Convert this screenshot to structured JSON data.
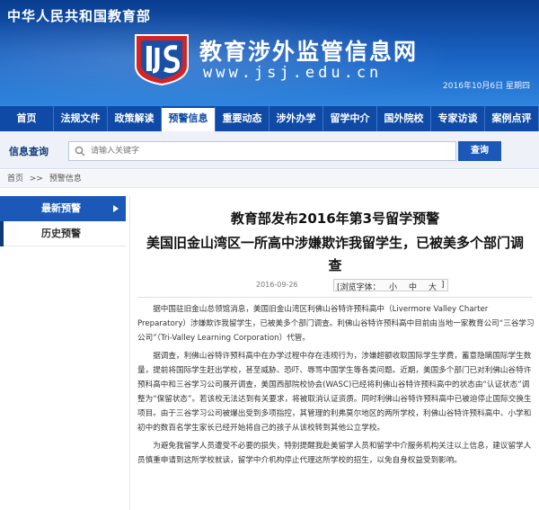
{
  "header": {
    "ministry": "中华人民共和国教育部",
    "site_title": "教育涉外监管信息网",
    "site_url": "www.jsj.edu.cn",
    "date": "2016年10月6日 星期四"
  },
  "nav": {
    "items": [
      "首页",
      "法规文件",
      "政策解读",
      "预警信息",
      "重要动态",
      "涉外办学",
      "留学中介",
      "国外院校",
      "专家访谈",
      "案例点评"
    ],
    "active_index": 3
  },
  "search": {
    "label": "信息查询",
    "placeholder": "请输入关键字",
    "button": "查询"
  },
  "breadcrumb": {
    "home": "首页",
    "sep": ">>",
    "current": "预警信息"
  },
  "sidebar": {
    "items": [
      {
        "label": "最新预警",
        "active": true
      },
      {
        "label": "历史预警",
        "active": false
      }
    ]
  },
  "article": {
    "title_line1": "教育部发布2016年第3号留学预警",
    "title_line2": "美国旧金山湾区一所高中涉嫌欺诈我留学生，已被美多个部门调查",
    "pub_date": "2016-09-26",
    "font_label": "[浏览字体：",
    "font_small": "小",
    "font_medium": "中",
    "font_large": "大",
    "font_end": "]",
    "paragraphs": [
      "据中国驻旧金山总领馆消息，美国旧金山湾区利佛山谷特许预科高中（Livermore Valley Charter Preparatory）涉嫌欺诈我留学生，已被美多个部门调查。利佛山谷特许预科高中目前由当地一家教育公司“三谷学习公司”（Tri-Valley Learning Corporation）代管。",
      "据调查，利佛山谷特许预科高中在办学过程中存在违规行为，涉嫌超额收取国际学生学费，蓄意隐瞒国际学生数量，提前将国际学生赶出学校，甚至威胁、恐吓、辱骂中国学生等各类问题。近期，美国多个部门已对利佛山谷特许预科高中和三谷学习公司展开调查，美国西部院校协会(WASC)已经将利佛山谷特许预科高中的状态由“认证状态”调整为“保留状态”。若该校无法达到有关要求，将被取消认证资质。同时利佛山谷特许预科高中已被迫停止国际交换生项目。由于三谷学习公司被爆出受到多项指控，其管理的利弗莫尔地区的两所学校，利佛山谷特许预科高中、小学和初中的数百名学生家长已经开始将自己的孩子从该校转到其他公立学校。",
      "为避免我留学人员遭受不必要的损失，特别提醒我赴美留学人员和留学中介服务机构关注以上信息，建议留学人员慎重申请到这所学校就读，留学中介机构停止代理这所学校的招生，以免自身权益受到影响。"
    ]
  },
  "colors": {
    "brand_blue": "#1b58b8",
    "nav_blue": "#0e4aa6",
    "banner_top": "#0a3d8f"
  }
}
